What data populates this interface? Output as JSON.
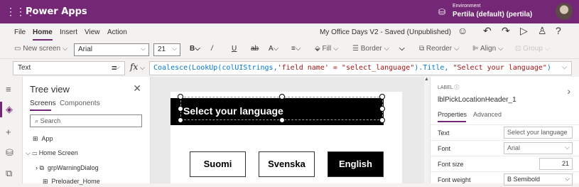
{
  "app": {
    "name": "Power Apps",
    "env_label": "Environment",
    "env_value": "Pertila (default) (pertila)"
  },
  "menu": {
    "items": [
      "File",
      "Home",
      "Insert",
      "View",
      "Action"
    ],
    "status": "My Office Days V2 - Saved (Unpublished)"
  },
  "toolbar": {
    "new_screen": "New screen",
    "font": "Arial",
    "size": "21",
    "fill": "Fill",
    "border": "Border",
    "reorder": "Reorder",
    "align": "Align",
    "group": "Group"
  },
  "formula": {
    "property": "Text",
    "fx": "fx",
    "p1": "Coalesce(LookUp(colUIStrings,",
    "s1": "'field name' = \"select_language\"",
    "p2": ").Title,",
    "s2": "\"Select your language\"",
    "p3": ")"
  },
  "tree": {
    "title": "Tree view",
    "tabs": [
      "Screens",
      "Components"
    ],
    "search_placeholder": "Search",
    "items": [
      "App",
      "Home Screen",
      "grpWarningDialog",
      "Preloader_Home"
    ]
  },
  "canvas": {
    "header": "Select your language",
    "buttons": [
      "Suomi",
      "Svenska",
      "English"
    ]
  },
  "props": {
    "type_label": "LABEL",
    "control_name": "lblPickLocationHeader_1",
    "tabs": [
      "Properties",
      "Advanced"
    ],
    "rows": [
      {
        "k": "Text",
        "v": "Select your language"
      },
      {
        "k": "Font",
        "v": "Arial"
      },
      {
        "k": "Font size",
        "v": "21"
      },
      {
        "k": "Font weight",
        "v": "B  Semibold"
      }
    ]
  }
}
